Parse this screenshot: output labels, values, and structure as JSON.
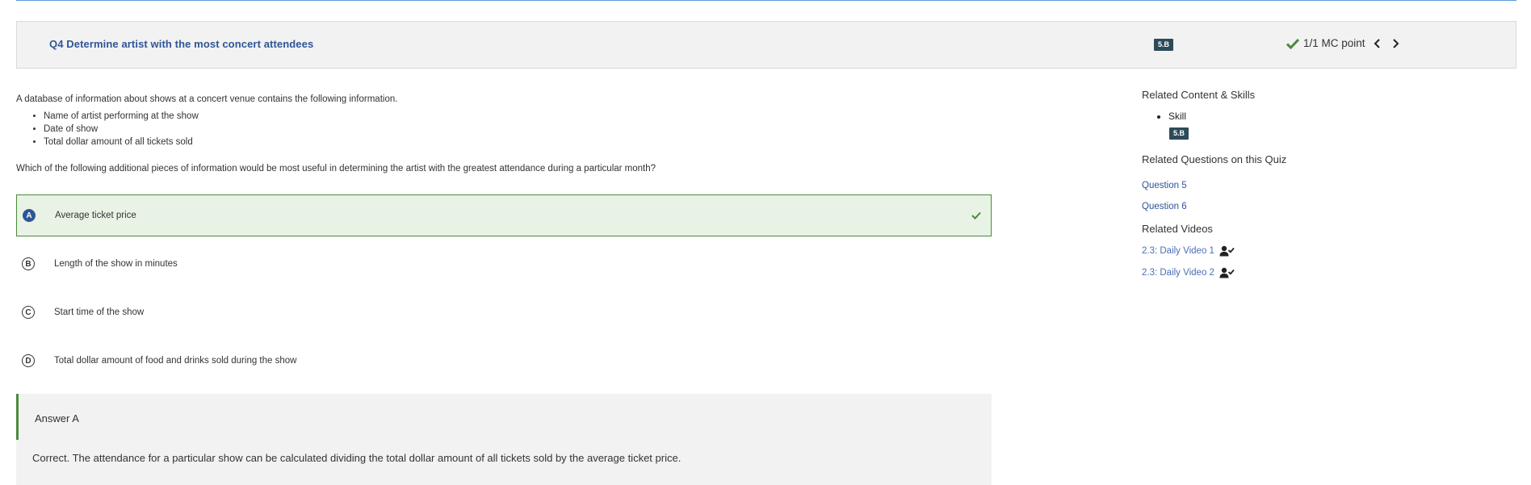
{
  "question": {
    "title": "Q4 Determine artist with the most concert attendees",
    "skill_badge": "5.B",
    "score": "1/1 MC point",
    "intro": "A database of information about shows at a concert venue contains the following information.",
    "bullets": [
      "Name of artist performing at the show",
      "Date of show",
      "Total dollar amount of all tickets sold"
    ],
    "prompt": "Which of the following additional pieces of information would be most useful in determining the artist with the greatest attendance during a particular month?"
  },
  "choices": [
    {
      "letter": "A",
      "text": "Average ticket price",
      "selected": true,
      "correct": true
    },
    {
      "letter": "B",
      "text": "Length of the show in minutes",
      "selected": false,
      "correct": false
    },
    {
      "letter": "C",
      "text": "Start time of the show",
      "selected": false,
      "correct": false
    },
    {
      "letter": "D",
      "text": "Total dollar amount of food and drinks sold during the show",
      "selected": false,
      "correct": false
    }
  ],
  "explanation": {
    "label": "Answer A",
    "text": "Correct. The attendance for a particular show can be calculated dividing the total dollar amount of all tickets sold by the average ticket price."
  },
  "sidebar": {
    "related_heading": "Related Content & Skills",
    "skill_label": "Skill",
    "skill_badge": "5.B",
    "questions_heading": "Related Questions on this Quiz",
    "questions": [
      "Question 5",
      "Question 6"
    ],
    "videos_heading": "Related Videos",
    "videos": [
      "2.3: Daily Video 1",
      "2.3: Daily Video 2"
    ]
  },
  "colors": {
    "correct_green": "#4a8a3a",
    "correct_bg": "#e8f3e6",
    "link_blue": "#2f5597",
    "badge_bg": "#2c4a5a"
  }
}
